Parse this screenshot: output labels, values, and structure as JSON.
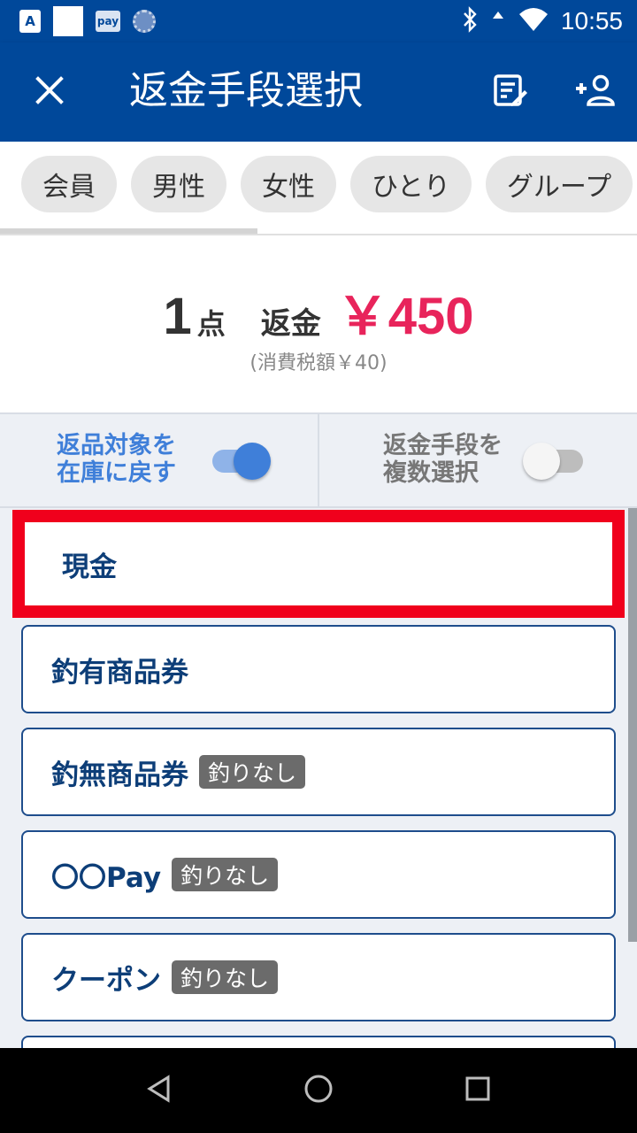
{
  "status_bar": {
    "notif_a": "A",
    "notif_pay": "pay",
    "time": "10:55",
    "icons": [
      "a-notification-icon",
      "white-square-icon",
      "pay-notification-icon",
      "circle-notification-icon",
      "bluetooth-icon",
      "signal-icon",
      "wifi-icon"
    ]
  },
  "header": {
    "title": "返金手段選択",
    "close_icon": "close-icon",
    "receipt_icon": "receipt-edit-icon",
    "add_person_icon": "add-person-icon"
  },
  "chips": [
    "会員",
    "男性",
    "女性",
    "ひとり",
    "グループ"
  ],
  "summary": {
    "count": "1",
    "count_unit": "点",
    "label": "返金",
    "amount": "￥450",
    "tax": "(消費税額￥40)"
  },
  "toggles": {
    "restock": {
      "line1": "返品対象を",
      "line2": "在庫に戻す",
      "on": true
    },
    "multi": {
      "line1": "返金手段を",
      "line2": "複数選択",
      "on": false
    }
  },
  "methods": [
    {
      "label": "現金",
      "badge": null,
      "selected": true
    },
    {
      "label": "釣有商品券",
      "badge": null,
      "selected": false
    },
    {
      "label": "釣無商品券",
      "badge": "釣りなし",
      "selected": false
    },
    {
      "label": "〇〇Pay",
      "badge": "釣りなし",
      "selected": false
    },
    {
      "label": "クーポン",
      "badge": "釣りなし",
      "selected": false
    }
  ],
  "colors": {
    "brand": "#00489a",
    "amount": "#e8245b",
    "highlight": "#f0001c",
    "toggle_on": "#3f7fd9"
  },
  "nav": [
    "back-icon",
    "home-icon",
    "recents-icon"
  ]
}
